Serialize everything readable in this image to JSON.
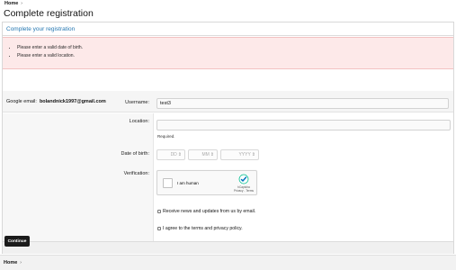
{
  "breadcrumb": {
    "home": "Home",
    "sep": "›"
  },
  "page": {
    "title": "Complete registration"
  },
  "block": {
    "header": "Complete your registration"
  },
  "errors": [
    "Please enter a valid date of birth.",
    "Please enter a valid location."
  ],
  "email": {
    "label": "Google email:",
    "value": "bolandnick1997@gmail.com"
  },
  "form": {
    "username_label": "Username:",
    "username_value": "test3",
    "location_label": "Location:",
    "location_value": "",
    "location_hint": "Required.",
    "dob_label": "Date of birth:",
    "dob_day_placeholder": "DD",
    "dob_month_placeholder": "MM",
    "dob_year_placeholder": "YYYY",
    "dob_arrow": "⇕",
    "verification_label": "Verification:",
    "captcha_text": "I am human",
    "captcha_brand": "hCaptcha",
    "captcha_links": "Privacy - Terms",
    "news_label": "Receive news and updates from us by email.",
    "terms_label": "I agree to the terms and privacy policy."
  },
  "actions": {
    "continue_label": "Continue"
  },
  "footer_breadcrumb": {
    "home": "Home",
    "sep": "›"
  },
  "colors": {
    "accent": "#2577b1",
    "error_bg": "#fde9e9",
    "button": "#1b1b1b"
  },
  "icons": {
    "captcha": "hcaptcha-logo-icon",
    "breadcrumb_sep": "chevron-right-icon"
  }
}
